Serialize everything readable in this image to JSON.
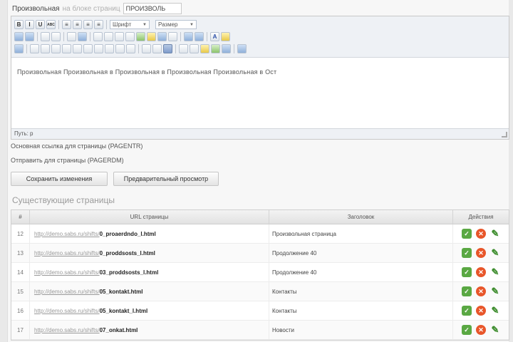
{
  "heading": {
    "label": "Произвольная",
    "sublabel": "на блоке страниц",
    "input_value": "ПРОИЗВОЛЬ"
  },
  "toolbar": {
    "row1": [
      "B",
      "I",
      "U",
      "ABC",
      "≡",
      "≡",
      "≡",
      "≡"
    ],
    "font_select": "Шрифт",
    "size_select": "Размер",
    "row2_icons": [
      "cut-icon",
      "copy-icon",
      "paste-icon",
      "paste-text-icon",
      "paste-word-icon",
      "find-icon",
      "replace-icon",
      "bullet-list-icon",
      "number-list-icon",
      "outdent-icon",
      "indent-icon",
      "undo-icon",
      "redo-icon",
      "link-icon",
      "unlink-icon",
      "anchor-icon",
      "image-icon",
      "cleanup-icon",
      "source-icon",
      "text-color-icon",
      "bg-color-icon"
    ],
    "row3_icons": [
      "table-icon",
      "row-props-icon",
      "cell-props-icon",
      "insert-row-before-icon",
      "insert-row-after-icon",
      "delete-row-icon",
      "insert-col-before-icon",
      "insert-col-after-icon",
      "delete-col-icon",
      "split-cells-icon",
      "merge-cells-icon",
      "hr-icon",
      "remove-format-icon",
      "visual-aid-icon",
      "sub-icon",
      "sup-icon",
      "char-map-icon",
      "media-icon",
      "line-icon",
      "fullscreen-icon"
    ]
  },
  "editor": {
    "content": "Произвольная Произвольная в Произвольная в Произвольная Произвольная в Ост",
    "status": "Путь: p"
  },
  "info": {
    "line1": "Основная ссылка для страницы (PAGENTR)",
    "line2": "Отправить для страницы (PAGERDM)"
  },
  "buttons": {
    "save": "Сохранить изменения",
    "preview": "Предварительный просмотр"
  },
  "section_title": "Существующие страницы",
  "table": {
    "headers": [
      "#",
      "URL страницы",
      "Заголовок",
      "Действия"
    ],
    "rows": [
      {
        "id": "12",
        "url_base": "http://demo.sabs.ru/shifts/",
        "url_page": "0_proaerdndo_l.html",
        "title": "Произвольная страница"
      },
      {
        "id": "13",
        "url_base": "http://demo.sabs.ru/shifts/",
        "url_page": "0_proddsosts_l.html",
        "title": "Продолжение 40"
      },
      {
        "id": "14",
        "url_base": "http://demo.sabs.ru/shifts/",
        "url_page": "03_proddsosts_l.html",
        "title": "Продолжение 40"
      },
      {
        "id": "15",
        "url_base": "http://demo.sabs.ru/shifts/",
        "url_page": "05_kontakt.html",
        "title": "Контакты"
      },
      {
        "id": "16",
        "url_base": "http://demo.sabs.ru/shifts/",
        "url_page": "05_kontakt_l.html",
        "title": "Контакты"
      },
      {
        "id": "17",
        "url_base": "http://demo.sabs.ru/shifts/",
        "url_page": "07_onkat.html",
        "title": "Новости"
      }
    ]
  }
}
